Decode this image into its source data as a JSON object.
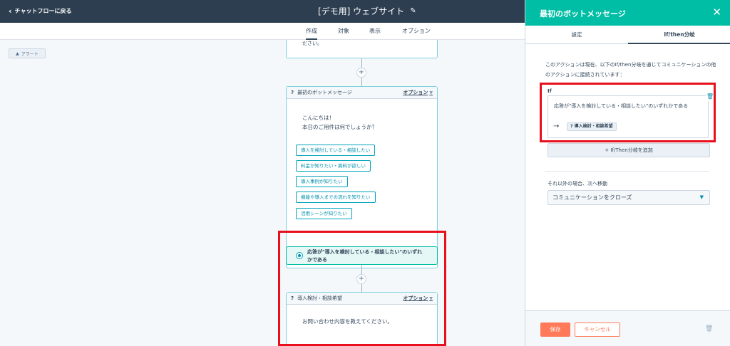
{
  "topbar": {
    "back_label": "チャットフローに戻る",
    "title": "[デモ用] ウェブサイト"
  },
  "tabs": [
    {
      "label": "作成",
      "active": true
    },
    {
      "label": "対象",
      "active": false
    },
    {
      "label": "表示",
      "active": false
    },
    {
      "label": "オプション",
      "active": false
    }
  ],
  "canvas": {
    "alert_label": "アラート",
    "top_card_text": "ださい。",
    "bot_message_1": {
      "title": "最初のボットメッセージ",
      "options_label": "オプション",
      "message_lines": [
        "こんにちは！",
        "本日のご用件は何でしょうか？"
      ],
      "choices": [
        "導入を検討している・相談したい",
        "料金が知りたい・資料が欲しい",
        "導入事例が知りたい",
        "機能や導入までの流れを知りたい",
        "活用シーンが知りたい"
      ]
    },
    "branch_text_line1": "応答が\"導入を検討している・相談したい\"のいずれ",
    "branch_text_line2": "かである",
    "bot_message_2": {
      "title": "導入検討・相談希望",
      "options_label": "オプション",
      "message": "お問い合わせ内容を教えてください。"
    }
  },
  "panel": {
    "title": "最初のボットメッセージ",
    "tabs": [
      {
        "label": "設定",
        "active": false
      },
      {
        "label": "If/then分岐",
        "active": true
      }
    ],
    "description": "このアクションは現在、以下のIf/then分岐を通じてコミュニケーションの他のアクションに接続されています：",
    "if_label": "If",
    "if_condition": "応答が\"導入を検討している・相談したい\"のいずれかである",
    "target_action": "? 導入検討・相談希望",
    "add_branch_label": "+ If/Then分岐を追加",
    "else_label": "それ以外の場合、次へ移動",
    "else_select_value": "コミュニケーションをクローズ",
    "save_label": "保存",
    "cancel_label": "キャンセル"
  },
  "colors": {
    "topbar": "#2d3e50",
    "panel_header": "#00bda5",
    "accent_link": "#0091ae",
    "highlight_box": "#e8101c",
    "save_button": "#ff7a59"
  }
}
